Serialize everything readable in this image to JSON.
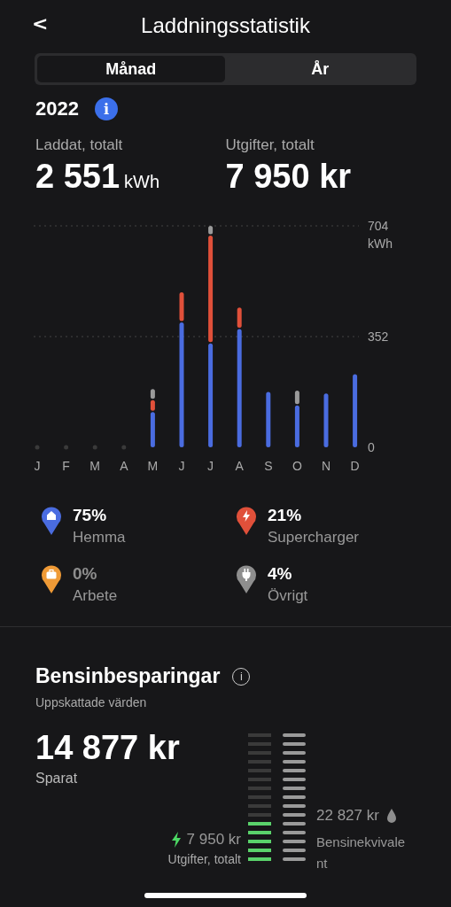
{
  "header": {
    "back": "<",
    "title": "Laddningsstatistik"
  },
  "tabs": [
    {
      "label": "Månad",
      "selected": false
    },
    {
      "label": "År",
      "selected": true
    }
  ],
  "period": {
    "year": "2022",
    "info": "i"
  },
  "totals": [
    {
      "label": "Laddat, totalt",
      "value": "2 551",
      "unit": "kWh"
    },
    {
      "label": "Utgifter, totalt",
      "value": "7 950 kr"
    }
  ],
  "chart_data": {
    "type": "bar",
    "stacked": true,
    "categories": [
      "J",
      "F",
      "M",
      "A",
      "M",
      "J",
      "J",
      "A",
      "S",
      "O",
      "N",
      "D"
    ],
    "ylim": [
      0,
      704
    ],
    "yticks": [
      0,
      352,
      {
        "value": 704,
        "label": "704"
      }
    ],
    "ylabel": "kWh",
    "series": [
      {
        "color": "#4a6ce0",
        "values": [
          0,
          0,
          0,
          0,
          112,
          397,
          330,
          376,
          176,
          133,
          171,
          232
        ]
      },
      {
        "color": "#e0503a",
        "values": [
          0,
          0,
          0,
          0,
          38,
          96,
          343,
          68,
          0,
          0,
          0,
          0
        ]
      },
      {
        "color": "#9a9a9a",
        "values": [
          0,
          0,
          0,
          0,
          35,
          0,
          31,
          0,
          0,
          47,
          0,
          0
        ]
      }
    ]
  },
  "legend": [
    {
      "kind": "home",
      "color": "#4a6ce0",
      "percent": "75%",
      "label": "Hemma",
      "muted": false
    },
    {
      "kind": "bolt",
      "color": "#e0503a",
      "percent": "21%",
      "label": "Supercharger",
      "muted": false
    },
    {
      "kind": "work",
      "color": "#ef9a36",
      "percent": "0%",
      "label": "Arbete",
      "muted": true
    },
    {
      "kind": "plug",
      "color": "#8e8e8e",
      "percent": "4%",
      "label": "Övrigt",
      "muted": false
    }
  ],
  "savings": {
    "title": "Bensinbesparingar",
    "info": "i",
    "subtitle": "Uppskattade värden",
    "amount": "14 877 kr",
    "amount_label": "Sparat",
    "cost": "7 950 kr",
    "cost_label": "Utgifter, totalt",
    "cost_meter": {
      "level": 0.34
    },
    "fuel": "22 827 kr",
    "fuel_label": "Bensinekvivalent"
  }
}
